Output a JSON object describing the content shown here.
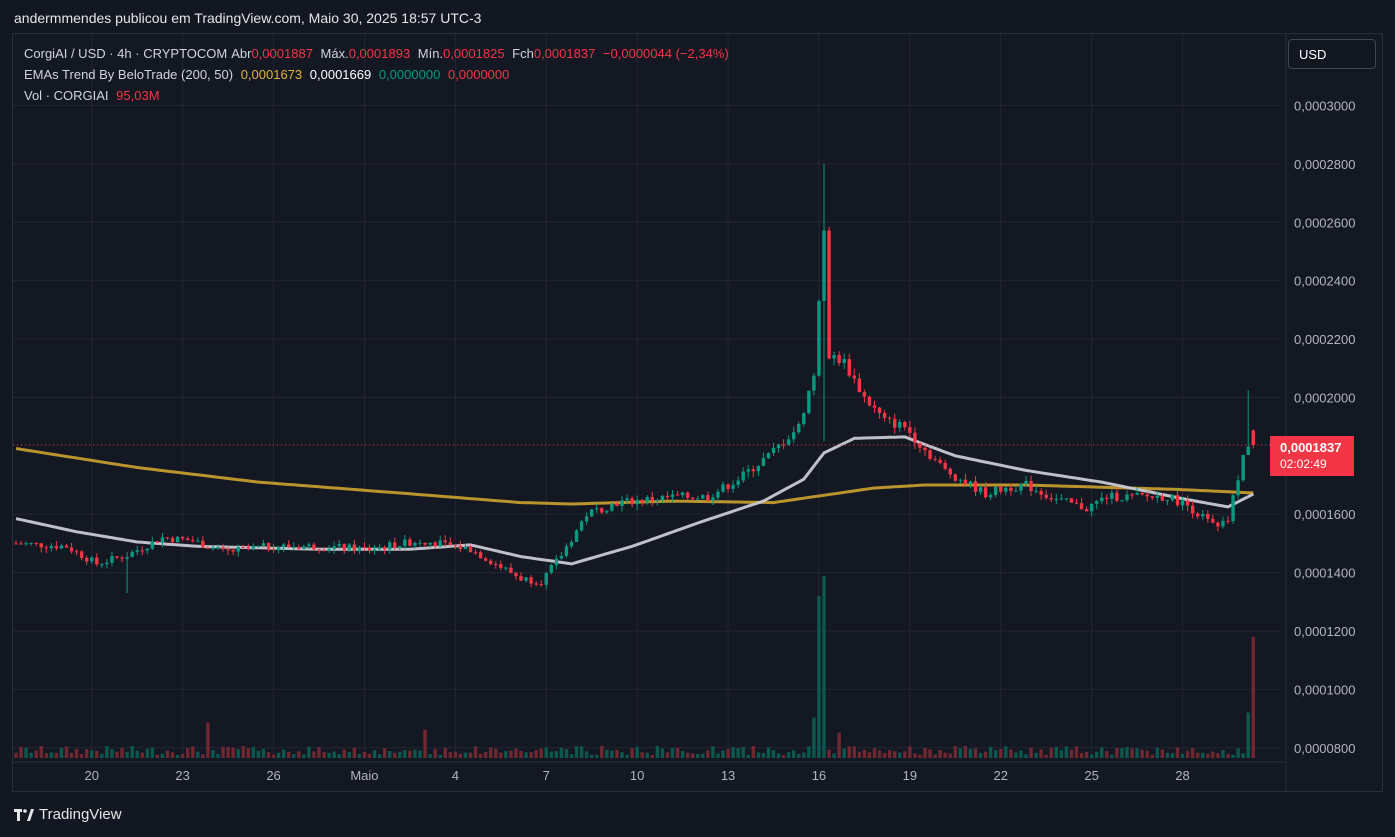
{
  "caption": "andermmendes publicou em TradingView.com, Maio 30, 2025 18:57 UTC-3",
  "legend": {
    "symbol_line": {
      "symbol": "CorgiAI / USD · 4h · CRYPTOCOM",
      "open_label": "Abr",
      "open_value": "0,0001887",
      "high_label": "Máx.",
      "high_value": "0,0001893",
      "low_label": "Mín.",
      "low_value": "0,0001825",
      "close_label": "Fch",
      "close_value": "0,0001837",
      "change": "−0,0000044 (−2,34%)"
    },
    "ema_line": {
      "name": "EMAs Trend By BeloTrade (200, 50)",
      "ema200": "0,0001673",
      "ema50": "0,0001669",
      "v3": "0,0000000",
      "v4": "0,0000000"
    },
    "vol_line": {
      "name": "Vol · CORGIAI",
      "value": "95,03M"
    }
  },
  "currency_button": "USD",
  "price_tag": {
    "price": "0,0001837",
    "countdown": "02:02:49"
  },
  "footer_logo": "TradingView",
  "colors": {
    "background": "#131722",
    "up": "#089981",
    "down": "#f23645",
    "ema200": "#c39b2e",
    "ema50": "#c9c9d2",
    "grid": "#232632"
  },
  "chart_data": {
    "type": "candlestick",
    "timeframe": "4h",
    "y_axis": {
      "ticks": [
        8e-05,
        0.0001,
        0.00012,
        0.00014,
        0.00016,
        0.0002,
        0.00022,
        0.00024,
        0.00026,
        0.00028,
        0.0003
      ],
      "tick_labels": [
        "0,0000800",
        "0,0001000",
        "0,0001200",
        "0,0001400",
        "0,0001600",
        "0,0002000",
        "0,0002200",
        "0,0002400",
        "0,0002600",
        "0,0002800",
        "0,0003000"
      ],
      "range": [
        7.65e-05,
        0.0003245
      ]
    },
    "x_axis": {
      "ticks": [
        {
          "label": "20",
          "index": 15
        },
        {
          "label": "23",
          "index": 33
        },
        {
          "label": "26",
          "index": 51
        },
        {
          "label": "Maio",
          "index": 69
        },
        {
          "label": "4",
          "index": 87
        },
        {
          "label": "7",
          "index": 105
        },
        {
          "label": "10",
          "index": 123
        },
        {
          "label": "13",
          "index": 141
        },
        {
          "label": "16",
          "index": 159
        },
        {
          "label": "19",
          "index": 177
        },
        {
          "label": "22",
          "index": 195
        },
        {
          "label": "25",
          "index": 213
        },
        {
          "label": "28",
          "index": 231
        }
      ]
    },
    "last_price": 0.0001837,
    "series_anchors": {
      "close_anchors": [
        [
          0,
          0.00015
        ],
        [
          10,
          0.000149
        ],
        [
          16,
          0.000143
        ],
        [
          22,
          0.000146
        ],
        [
          29,
          0.000152
        ],
        [
          35,
          0.000151
        ],
        [
          41,
          0.000147
        ],
        [
          50,
          0.000149
        ],
        [
          60,
          0.000149
        ],
        [
          70,
          0.000148
        ],
        [
          80,
          0.000151
        ],
        [
          90,
          0.000148
        ],
        [
          100,
          0.000138
        ],
        [
          104,
          0.000137
        ],
        [
          108,
          0.000146
        ],
        [
          113,
          0.00016
        ],
        [
          119,
          0.000164
        ],
        [
          125,
          0.000165
        ],
        [
          131,
          0.000166
        ],
        [
          137,
          0.000166
        ],
        [
          143,
          0.000172
        ],
        [
          149,
          0.00018
        ],
        [
          155,
          0.00019
        ],
        [
          158,
          0.000208
        ],
        [
          160,
          0.000255
        ],
        [
          161,
          0.000215
        ],
        [
          164,
          0.000212
        ],
        [
          168,
          0.0002
        ],
        [
          172,
          0.000192
        ],
        [
          176,
          0.00019
        ],
        [
          180,
          0.000182
        ],
        [
          184,
          0.000175
        ],
        [
          188,
          0.000171
        ],
        [
          192,
          0.000167
        ],
        [
          196,
          0.000169
        ],
        [
          200,
          0.00017
        ],
        [
          206,
          0.000165
        ],
        [
          212,
          0.000162
        ],
        [
          216,
          0.000166
        ],
        [
          222,
          0.000166
        ],
        [
          228,
          0.000166
        ],
        [
          232,
          0.000163
        ],
        [
          238,
          0.000155
        ],
        [
          240,
          0.000158
        ],
        [
          243,
          0.00018
        ],
        [
          245,
          0.000184
        ]
      ],
      "ema200_anchors": [
        [
          0,
          0.0001825
        ],
        [
          24,
          0.000176
        ],
        [
          48,
          0.000171
        ],
        [
          78,
          0.000167
        ],
        [
          100,
          0.000164
        ],
        [
          110,
          0.0001635
        ],
        [
          130,
          0.0001645
        ],
        [
          150,
          0.000164
        ],
        [
          160,
          0.0001665
        ],
        [
          170,
          0.000169
        ],
        [
          180,
          0.00017
        ],
        [
          200,
          0.00017
        ],
        [
          230,
          0.0001685
        ],
        [
          245,
          0.0001673
        ]
      ],
      "ema50_anchors": [
        [
          0,
          0.0001585
        ],
        [
          12,
          0.000154
        ],
        [
          24,
          0.0001505
        ],
        [
          36,
          0.000149
        ],
        [
          60,
          0.000148
        ],
        [
          78,
          0.000148
        ],
        [
          90,
          0.0001495
        ],
        [
          100,
          0.0001455
        ],
        [
          110,
          0.000143
        ],
        [
          122,
          0.000149
        ],
        [
          135,
          0.000157
        ],
        [
          148,
          0.0001645
        ],
        [
          156,
          0.000172
        ],
        [
          160,
          0.000181
        ],
        [
          166,
          0.000186
        ],
        [
          176,
          0.0001865
        ],
        [
          186,
          0.00018
        ],
        [
          200,
          0.000175
        ],
        [
          215,
          0.000171
        ],
        [
          232,
          0.000165
        ],
        [
          240,
          0.0001625
        ],
        [
          245,
          0.0001669
        ]
      ],
      "volume_spikes_millions": {
        "38": 35,
        "81": 28,
        "159": 160,
        "160": 180,
        "158": 40,
        "163": 25,
        "244": 45,
        "245": 120,
        "246": 28
      }
    },
    "candle_count": 246,
    "volume_scale_max_millions": 180
  }
}
